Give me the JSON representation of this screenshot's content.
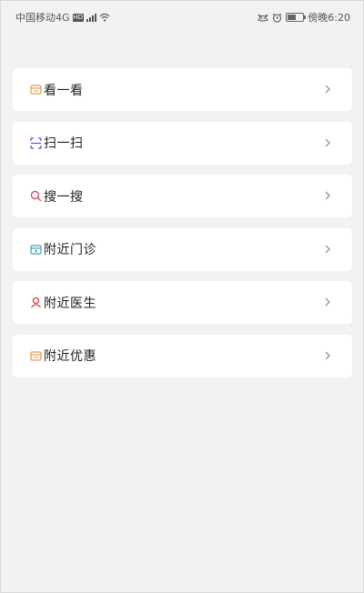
{
  "status_bar": {
    "carrier": "中国移动4G",
    "time": "傍晚6:20"
  },
  "menu": {
    "items": [
      {
        "label": "看一看",
        "icon": "calendar-icon",
        "icon_color": "#e8a050"
      },
      {
        "label": "扫一扫",
        "icon": "scan-icon",
        "icon_color": "#6a4bd8"
      },
      {
        "label": "搜一搜",
        "icon": "search-icon",
        "icon_color": "#e0506a"
      },
      {
        "label": "附近门诊",
        "icon": "clinic-icon",
        "icon_color": "#3fa9b5"
      },
      {
        "label": "附近医生",
        "icon": "doctor-icon",
        "icon_color": "#d94040"
      },
      {
        "label": "附近优惠",
        "icon": "coupon-icon",
        "icon_color": "#e8a050"
      }
    ]
  }
}
